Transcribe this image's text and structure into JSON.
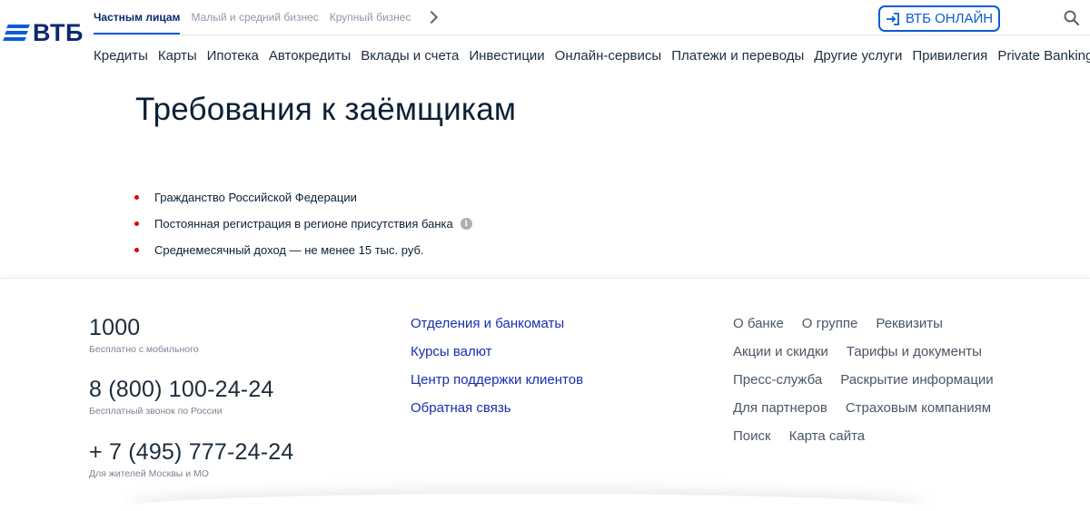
{
  "header": {
    "logo_text": "ВТБ",
    "segments": [
      {
        "label": "Частным лицам",
        "active": true
      },
      {
        "label": "Малый и средний бизнес",
        "active": false
      },
      {
        "label": "Крупный бизнес",
        "active": false
      }
    ],
    "online_button_label": "ВТБ ОНЛАЙН",
    "nav": [
      "Кредиты",
      "Карты",
      "Ипотека",
      "Автокредиты",
      "Вклады и счета",
      "Инвестиции",
      "Онлайн-сервисы",
      "Платежи и переводы",
      "Другие услуги",
      "Привилегия",
      "Private Banking"
    ]
  },
  "content": {
    "title": "Требования к заёмщикам",
    "requirements": [
      "Гражданство Российской Федерации",
      "Постоянная регистрация в регионе присутствия банка",
      "Среднемесячный доход — не менее 15 тыс. руб."
    ],
    "info_icon_text": "i"
  },
  "footer": {
    "phones": [
      {
        "number": "1000",
        "note": "Бесплатно с мобильного"
      },
      {
        "number": "8 (800) 100-24-24",
        "note": "Бесплатный звонок по России"
      },
      {
        "number": "+ 7 (495) 777-24-24",
        "note": "Для жителей Москвы и МО"
      }
    ],
    "links": [
      "Отделения и банкоматы",
      "Курсы валют",
      "Центр поддержки клиентов",
      "Обратная связь"
    ],
    "right_links": [
      [
        "О банке",
        "О группе",
        "Реквизиты"
      ],
      [
        "Акции и скидки",
        "Тарифы и документы"
      ],
      [
        "Пресс-служба",
        "Раскрытие информации"
      ],
      [
        "Для партнеров",
        "Страховым компаниям"
      ],
      [
        "Поиск",
        "Карта сайта"
      ]
    ]
  },
  "colors": {
    "brand_blue": "#0a5cd6",
    "brand_dark": "#0a2973",
    "link_blue": "#1a2eb0",
    "bullet_red": "#e00000"
  },
  "icons": [
    "login-icon",
    "search-icon",
    "chevron-right-icon",
    "info-icon"
  ]
}
